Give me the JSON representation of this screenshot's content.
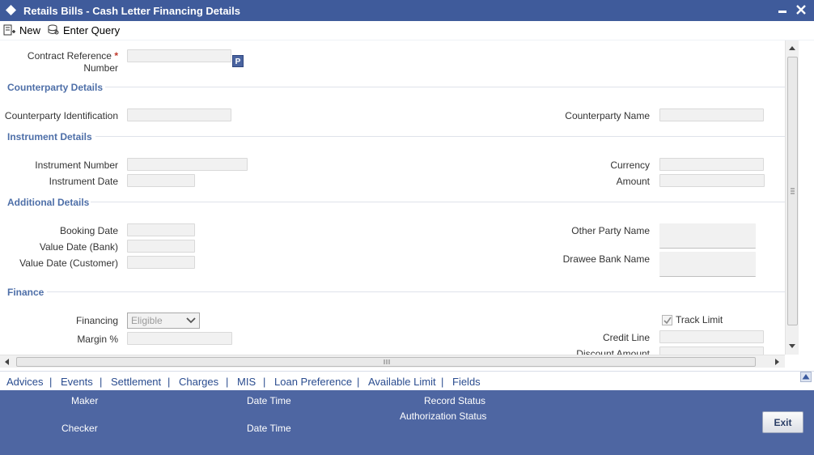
{
  "window": {
    "title": "Retails Bills - Cash Letter Financing Details",
    "icon": "diamond-icon",
    "controls": [
      "minimize-icon",
      "close-icon"
    ]
  },
  "toolbar": {
    "new_label": "New",
    "enter_query_label": "Enter Query"
  },
  "contract": {
    "label_line1": "Contract Reference",
    "label_line2": "Number",
    "required_mark": "*",
    "value": "",
    "lookup_label": "P"
  },
  "sections": {
    "counterparty": "Counterparty Details",
    "instrument": "Instrument Details",
    "additional": "Additional Details",
    "finance": "Finance"
  },
  "counterparty": {
    "identification_label": "Counterparty Identification",
    "identification_value": "",
    "name_label": "Counterparty Name",
    "name_value": ""
  },
  "instrument": {
    "number_label": "Instrument Number",
    "number_value": "",
    "date_label": "Instrument Date",
    "date_value": "",
    "currency_label": "Currency",
    "currency_value": "",
    "amount_label": "Amount",
    "amount_value": ""
  },
  "additional": {
    "booking_date_label": "Booking Date",
    "value_date_bank_label": "Value Date (Bank)",
    "value_date_customer_label": "Value Date (Customer)",
    "other_party_label": "Other Party Name",
    "drawee_bank_label": "Drawee Bank Name"
  },
  "finance": {
    "financing_label": "Financing",
    "financing_selected": "Eligible",
    "margin_label": "Margin %",
    "track_limit_label": "Track Limit",
    "track_limit_checked": true,
    "credit_line_label": "Credit Line",
    "discount_amount_label": "Discount Amount"
  },
  "tabs": {
    "items": [
      "Advices",
      "Events",
      "Settlement",
      "Charges",
      "MIS",
      "Loan Preference",
      "Available Limit",
      "Fields"
    ],
    "separator": "|"
  },
  "footer": {
    "maker_label": "Maker",
    "date_time_label": "Date Time",
    "record_status_label": "Record Status",
    "checker_label": "Checker",
    "authorization_status_label": "Authorization Status",
    "exit_label": "Exit"
  },
  "colors": {
    "titlebar": "#3f5b9b",
    "section_heading": "#4e6fa8",
    "tab_link": "#2a4c8f",
    "footer": "#4e66a2",
    "required": "#c0392b"
  }
}
